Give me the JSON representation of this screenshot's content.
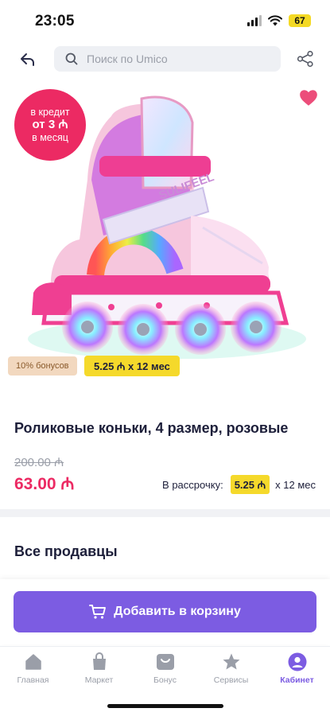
{
  "status_bar": {
    "time": "23:05",
    "battery": "67"
  },
  "nav": {
    "search_placeholder": "Поиск по Umico"
  },
  "promo": {
    "credit_line1": "в кредит",
    "credit_line2": "от 3 ₼",
    "credit_line3": "в месяц",
    "bonus": "10% бонусов",
    "installment": "5.25 ₼ x 12 мес"
  },
  "product": {
    "title": "Роликовые коньки, 4 размер, розовые",
    "old_price": "200.00 ₼",
    "price": "63.00 ₼",
    "installment_label": "В рассрочку:",
    "installment_amount": "5.25 ₼",
    "installment_term": "x 12 мес"
  },
  "sections": {
    "sellers_title": "Все продавцы"
  },
  "actions": {
    "add_to_cart": "Добавить в корзину"
  },
  "tabs": [
    {
      "label": "Главная",
      "icon": "home-icon"
    },
    {
      "label": "Маркет",
      "icon": "bag-icon"
    },
    {
      "label": "Бонус",
      "icon": "bonus-icon"
    },
    {
      "label": "Сервисы",
      "icon": "star-icon"
    },
    {
      "label": "Кабинет",
      "icon": "profile-icon",
      "active": true
    }
  ],
  "colors": {
    "accent": "#7c5ce2",
    "price": "#ec2a63",
    "highlight": "#f5d92b",
    "inactive": "#9a9ea8"
  }
}
